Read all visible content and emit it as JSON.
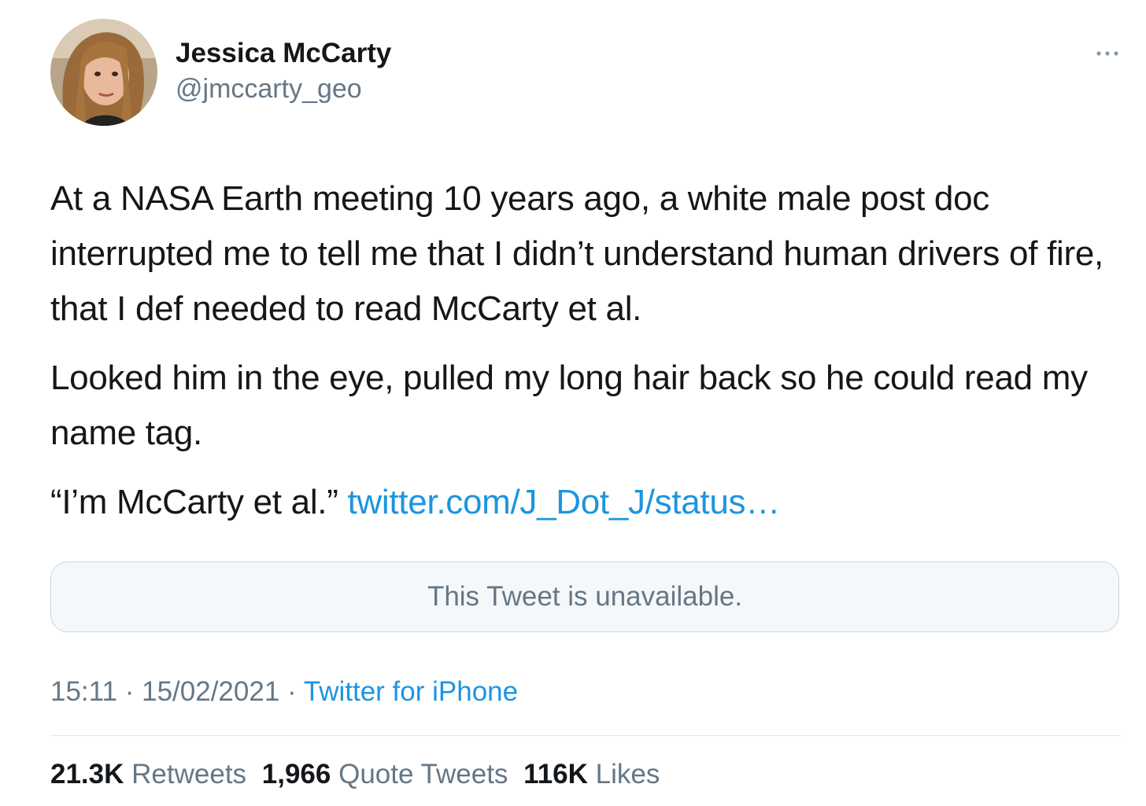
{
  "user": {
    "display_name": "Jessica McCarty",
    "handle": "@jmccarty_geo",
    "avatar_icon": "avatar-photo"
  },
  "menu_icon": "more-horizontal-icon",
  "tweet": {
    "paragraph1": "At a NASA Earth meeting 10 years ago, a white male post doc interrupted me to tell me that I didn’t understand human drivers of fire, that I def needed to read McCarty et al.",
    "paragraph2": "Looked him in the eye, pulled my long hair back so he could read my name tag.",
    "paragraph3_text": "“I’m McCarty et al.” ",
    "paragraph3_link": "twitter.com/J_Dot_J/status…"
  },
  "quoted_tweet": {
    "message": "This Tweet is unavailable."
  },
  "meta": {
    "time": "15:11",
    "separator": " · ",
    "date": "15/02/2021",
    "source": "Twitter for iPhone"
  },
  "stats": {
    "retweets_count": "21.3K",
    "retweets_label": "Retweets",
    "quotes_count": "1,966",
    "quotes_label": "Quote Tweets",
    "likes_count": "116K",
    "likes_label": "Likes"
  },
  "colors": {
    "link": "#1b95e0",
    "secondary_text": "#657786",
    "primary_text": "#14171a",
    "border": "#ccd6dd"
  }
}
